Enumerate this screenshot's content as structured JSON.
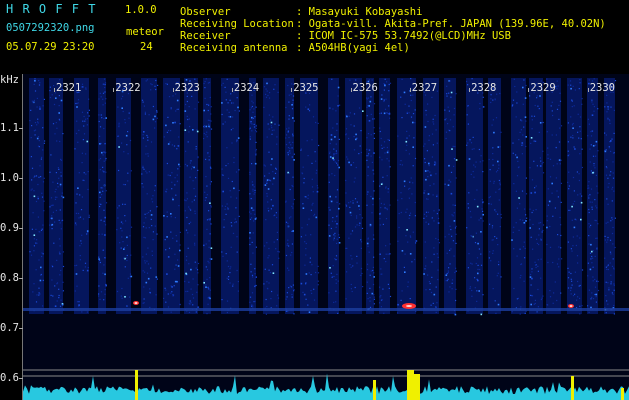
{
  "app": {
    "name": "H R O F F T",
    "version": "1.0.0"
  },
  "file": {
    "name": "0507292320.png",
    "datetime": "05.07.29 23:20"
  },
  "meteor": {
    "label": "meteor",
    "count": "24"
  },
  "info": {
    "observer_label": "Observer",
    "observer_value": ": Masayuki Kobayashi",
    "location_label": "Receiving Location",
    "location_value": ": Ogata-vill. Akita-Pref. JAPAN (139.96E, 40.02N)",
    "receiver_label": "Receiver",
    "receiver_value": ": ICOM IC-575 53.7492(@LCD)MHz USB",
    "antenna_label": "Receiving antenna",
    "antenna_value": ": A504HB(yagi 4el)"
  },
  "axis": {
    "unit": "kHz",
    "y_labels": [
      "1.1",
      "1.0",
      "0.9",
      "0.8",
      "0.7",
      "0.6"
    ],
    "x_labels": [
      "2321",
      "2322",
      "2323",
      "2324",
      "2325",
      "2326",
      "2327",
      "2328",
      "2329",
      "2330"
    ]
  },
  "colors": {
    "cyan": "#3fd7e6",
    "yellow": "#f0f000",
    "bg": "#000000"
  }
}
